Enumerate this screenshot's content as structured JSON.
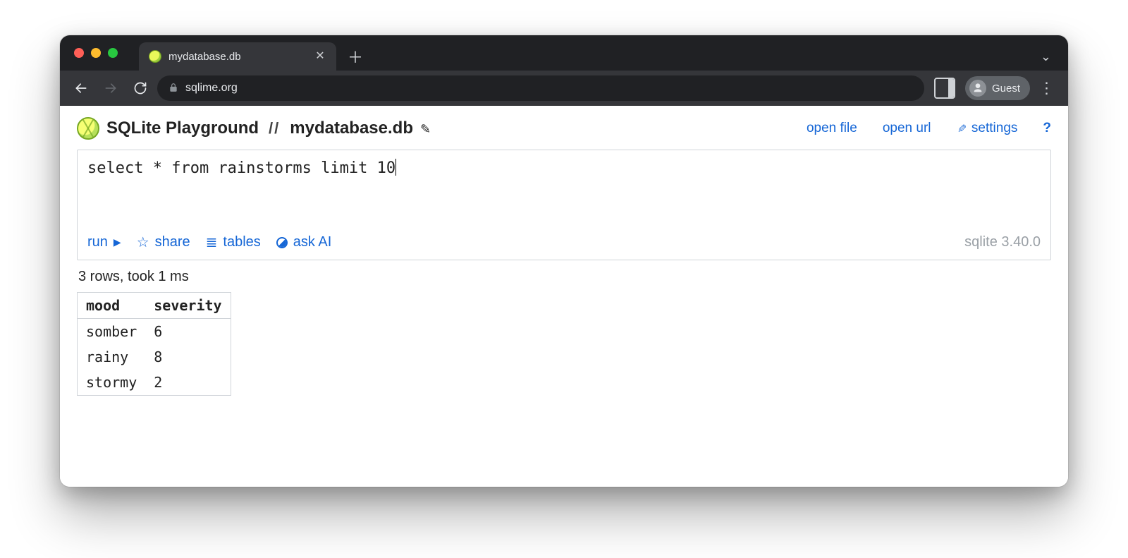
{
  "browser": {
    "tab_title": "mydatabase.db",
    "url_host": "sqlime.org",
    "profile_label": "Guest"
  },
  "header": {
    "app_title": "SQLite Playground",
    "separator": "//",
    "db_name": "mydatabase.db",
    "links": {
      "open_file": "open file",
      "open_url": "open url",
      "settings": "settings",
      "help": "?"
    }
  },
  "editor": {
    "sql": "select * from rainstorms limit 10",
    "actions": {
      "run": "run",
      "share": "share",
      "tables": "tables",
      "ask_ai": "ask AI"
    },
    "version": "sqlite 3.40.0"
  },
  "result": {
    "status": "3 rows, took 1 ms",
    "columns": [
      "mood",
      "severity"
    ],
    "rows": [
      {
        "mood": "somber",
        "severity": 6
      },
      {
        "mood": "rainy",
        "severity": 8
      },
      {
        "mood": "stormy",
        "severity": 2
      }
    ]
  }
}
